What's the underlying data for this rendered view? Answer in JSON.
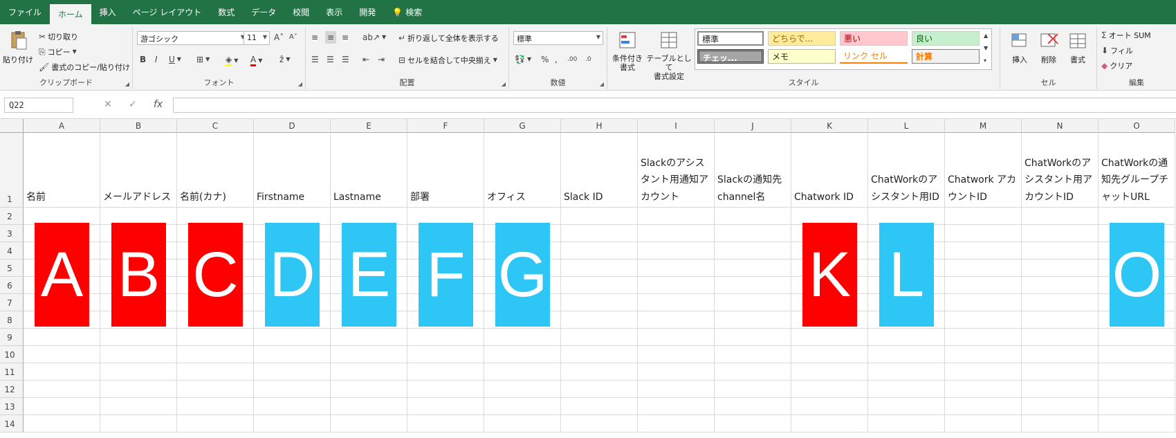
{
  "tabs": [
    "ファイル",
    "ホーム",
    "挿入",
    "ページ レイアウト",
    "数式",
    "データ",
    "校閲",
    "表示",
    "開発",
    "検索"
  ],
  "clipboard": {
    "paste": "貼り付け",
    "cut": "切り取り",
    "copy": "コピー",
    "format_painter": "書式のコピー/貼り付け",
    "label": "クリップボード"
  },
  "font": {
    "name": "游ゴシック",
    "size": "11",
    "label": "フォント"
  },
  "alignment": {
    "wrap": "折り返して全体を表示する",
    "merge": "セルを結合して中央揃え",
    "label": "配置"
  },
  "number": {
    "format": "標準",
    "label": "数値"
  },
  "styles": {
    "conditional": "条件付き\n書式",
    "table": "テーブルとして\n書式設定",
    "cells": [
      "標準",
      "どちらで...",
      "悪い",
      "良い",
      "チェッ...",
      "メモ",
      "リンク セル",
      "計算"
    ],
    "label": "スタイル"
  },
  "cells_group": {
    "insert": "挿入",
    "delete": "削除",
    "format": "書式",
    "label": "セル"
  },
  "editing": {
    "autosum": "オート SUM",
    "fill": "フィル",
    "clear": "クリア",
    "label": "編集"
  },
  "formula_bar": {
    "name_box": "Q22",
    "fx": "fx"
  },
  "columns": [
    "A",
    "B",
    "C",
    "D",
    "E",
    "F",
    "G",
    "H",
    "I",
    "J",
    "K",
    "L",
    "M",
    "N",
    "O"
  ],
  "rows": [
    "1",
    "2",
    "3",
    "4",
    "5",
    "6",
    "7",
    "8",
    "9",
    "10",
    "11",
    "12",
    "13",
    "14"
  ],
  "headers": {
    "A": "名前",
    "B": "メールアドレス",
    "C": "名前(カナ)",
    "D": "Firstname",
    "E": "Lastname",
    "F": "部署",
    "G": "オフィス",
    "H": "Slack ID",
    "I": "Slackのアシスタント用通知アカウント",
    "J": "Slackの通知先channel名",
    "K": "Chatwork ID",
    "L": "ChatWorkのアシスタント用ID",
    "M": "Chatwork アカウントID",
    "N": "ChatWorkのアシスタント用アカウントID",
    "O": "ChatWorkの通知先グループチャットURL"
  },
  "badges": [
    {
      "letter": "A",
      "color": "#ff0000"
    },
    {
      "letter": "B",
      "color": "#ff0000"
    },
    {
      "letter": "C",
      "color": "#ff0000"
    },
    {
      "letter": "D",
      "color": "#2ec7f5"
    },
    {
      "letter": "E",
      "color": "#2ec7f5"
    },
    {
      "letter": "F",
      "color": "#2ec7f5"
    },
    {
      "letter": "G",
      "color": "#2ec7f5"
    },
    {
      "letter": "K",
      "color": "#ff0000"
    },
    {
      "letter": "L",
      "color": "#2ec7f5"
    },
    {
      "letter": "O",
      "color": "#2ec7f5"
    }
  ],
  "colors": {
    "excel_green": "#217346",
    "red": "#ff0000",
    "blue": "#2ec7f5"
  }
}
